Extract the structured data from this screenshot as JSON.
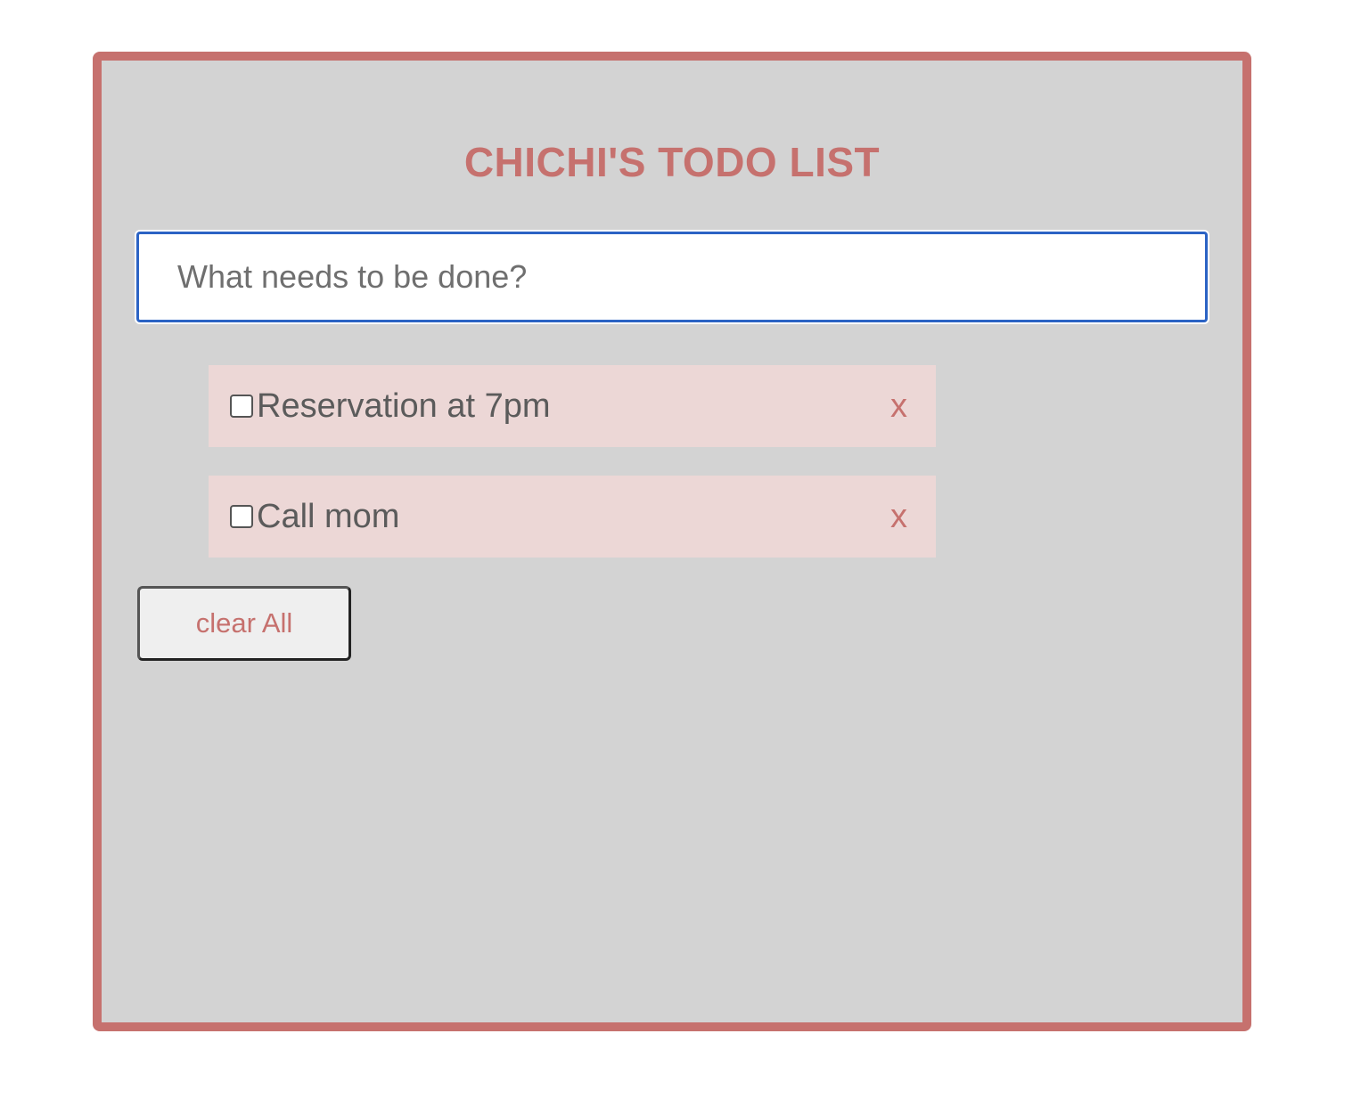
{
  "app": {
    "title": "CHICHI'S TODO LIST",
    "accent_color": "#c6716e",
    "panel_color": "#d3d3d3",
    "item_color": "#ecd7d6"
  },
  "input": {
    "value": "",
    "placeholder": "What needs to be done?"
  },
  "todos": [
    {
      "text": "Reservation at 7pm",
      "checked": false,
      "delete_label": "x"
    },
    {
      "text": "Call mom",
      "checked": false,
      "delete_label": "x"
    }
  ],
  "actions": {
    "clear_all_label": "clear All"
  }
}
